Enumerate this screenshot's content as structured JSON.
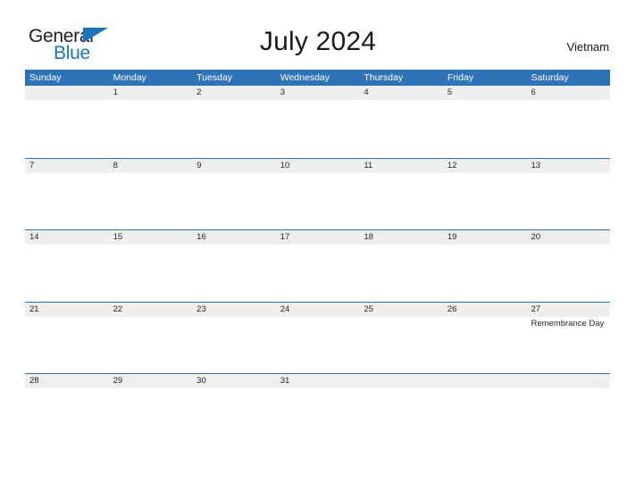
{
  "brand": {
    "name_part1": "General",
    "name_part2": "Blue",
    "triangle_icon": "triangle-icon",
    "color_primary": "#1b75bb",
    "color_text": "#231f20"
  },
  "header": {
    "title": "July 2024",
    "country": "Vietnam"
  },
  "calendar": {
    "header_bg": "#2e72b8",
    "band_bg": "#efefef",
    "weekdays": [
      "Sunday",
      "Monday",
      "Tuesday",
      "Wednesday",
      "Thursday",
      "Friday",
      "Saturday"
    ],
    "weeks": [
      [
        {
          "day": "",
          "event": ""
        },
        {
          "day": "1",
          "event": ""
        },
        {
          "day": "2",
          "event": ""
        },
        {
          "day": "3",
          "event": ""
        },
        {
          "day": "4",
          "event": ""
        },
        {
          "day": "5",
          "event": ""
        },
        {
          "day": "6",
          "event": ""
        }
      ],
      [
        {
          "day": "7",
          "event": ""
        },
        {
          "day": "8",
          "event": ""
        },
        {
          "day": "9",
          "event": ""
        },
        {
          "day": "10",
          "event": ""
        },
        {
          "day": "11",
          "event": ""
        },
        {
          "day": "12",
          "event": ""
        },
        {
          "day": "13",
          "event": ""
        }
      ],
      [
        {
          "day": "14",
          "event": ""
        },
        {
          "day": "15",
          "event": ""
        },
        {
          "day": "16",
          "event": ""
        },
        {
          "day": "17",
          "event": ""
        },
        {
          "day": "18",
          "event": ""
        },
        {
          "day": "19",
          "event": ""
        },
        {
          "day": "20",
          "event": ""
        }
      ],
      [
        {
          "day": "21",
          "event": ""
        },
        {
          "day": "22",
          "event": ""
        },
        {
          "day": "23",
          "event": ""
        },
        {
          "day": "24",
          "event": ""
        },
        {
          "day": "25",
          "event": ""
        },
        {
          "day": "26",
          "event": ""
        },
        {
          "day": "27",
          "event": "Remembrance Day"
        }
      ],
      [
        {
          "day": "28",
          "event": ""
        },
        {
          "day": "29",
          "event": ""
        },
        {
          "day": "30",
          "event": ""
        },
        {
          "day": "31",
          "event": ""
        },
        {
          "day": "",
          "event": ""
        },
        {
          "day": "",
          "event": ""
        },
        {
          "day": "",
          "event": ""
        }
      ]
    ]
  }
}
